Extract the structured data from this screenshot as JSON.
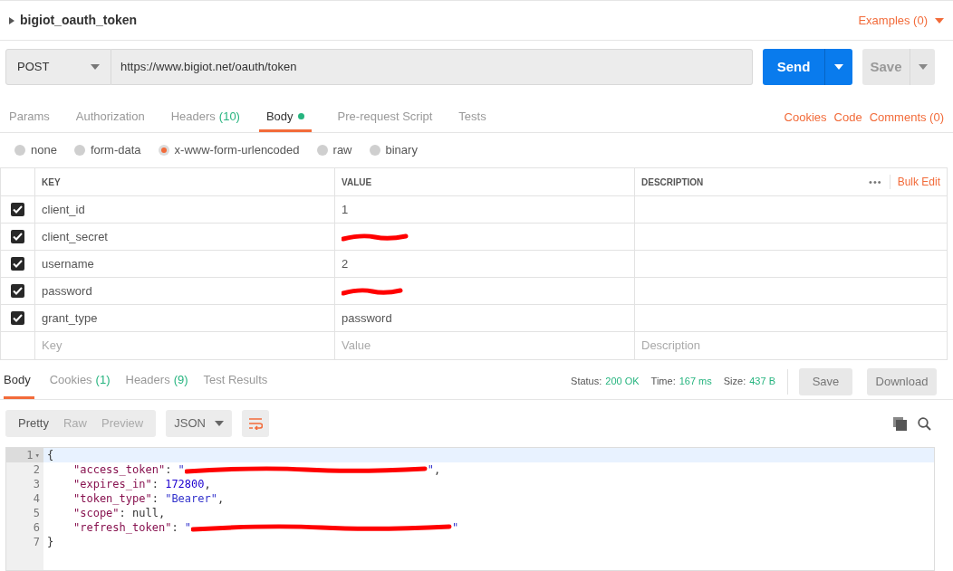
{
  "request_name": "bigiot_oauth_token",
  "examples": "Examples (0)",
  "method": "POST",
  "url": "https://www.bigiot.net/oauth/token",
  "send": "Send",
  "save": "Save",
  "request_tabs": [
    {
      "label": "Params",
      "selected": false
    },
    {
      "label": "Authorization",
      "selected": false
    },
    {
      "label": "Headers",
      "count": "(10)",
      "selected": false
    },
    {
      "label": "Body",
      "dot": true,
      "selected": true
    },
    {
      "label": "Pre-request Script",
      "selected": false
    },
    {
      "label": "Tests",
      "selected": false
    }
  ],
  "request_links": [
    "Cookies",
    "Code",
    "Comments (0)"
  ],
  "body_modes": [
    {
      "label": "none",
      "selected": false
    },
    {
      "label": "form-data",
      "selected": false
    },
    {
      "label": "x-www-form-urlencoded",
      "selected": true
    },
    {
      "label": "raw",
      "selected": false
    },
    {
      "label": "binary",
      "selected": false
    }
  ],
  "table": {
    "columns": [
      "KEY",
      "VALUE",
      "DESCRIPTION"
    ],
    "more": "•••",
    "bulk_edit": "Bulk Edit",
    "rows": [
      {
        "checked": true,
        "key": "client_id",
        "value": "1",
        "redacted": false
      },
      {
        "checked": true,
        "key": "client_secret",
        "redacted": true
      },
      {
        "checked": true,
        "key": "username",
        "value": "2",
        "redacted": false
      },
      {
        "checked": true,
        "key": "password",
        "redacted": true
      },
      {
        "checked": true,
        "key": "grant_type",
        "value": "password",
        "redacted": false
      }
    ],
    "placeholders": [
      "Key",
      "Value",
      "Description"
    ]
  },
  "response_tabs": [
    {
      "label": "Body",
      "selected": true
    },
    {
      "label": "Cookies",
      "count": "(1)",
      "selected": false
    },
    {
      "label": "Headers",
      "count": "(9)",
      "selected": false
    },
    {
      "label": "Test Results",
      "selected": false
    }
  ],
  "stats": [
    {
      "label": "Status:",
      "value": "200 OK"
    },
    {
      "label": "Time:",
      "value": "167 ms"
    },
    {
      "label": "Size:",
      "value": "437 B"
    }
  ],
  "response_buttons": [
    "Save",
    "Download"
  ],
  "view_modes": [
    {
      "label": "Pretty",
      "selected": true
    },
    {
      "label": "Raw",
      "selected": false
    },
    {
      "label": "Preview",
      "selected": false
    }
  ],
  "format": "JSON",
  "code": [
    {
      "num": "1",
      "fold": "▾",
      "text": "{"
    },
    {
      "num": "2",
      "key": "\"access_token\"",
      "sep": ": ",
      "value": "\"",
      "redacted": true,
      "value_end": "\"",
      "suffix": ","
    },
    {
      "num": "3",
      "key": "\"expires_in\"",
      "sep": ": ",
      "value": "172800",
      "kind": "number",
      "suffix": ","
    },
    {
      "num": "4",
      "key": "\"token_type\"",
      "sep": ": ",
      "value": "\"Bearer\"",
      "kind": "string",
      "suffix": ","
    },
    {
      "num": "5",
      "key": "\"scope\"",
      "sep": ": ",
      "value": "null",
      "kind": "null",
      "suffix": ","
    },
    {
      "num": "6",
      "key": "\"refresh_token\"",
      "sep": ": ",
      "value": "\"",
      "redacted": true,
      "value_end": "\""
    },
    {
      "num": "7",
      "text": "}"
    }
  ]
}
